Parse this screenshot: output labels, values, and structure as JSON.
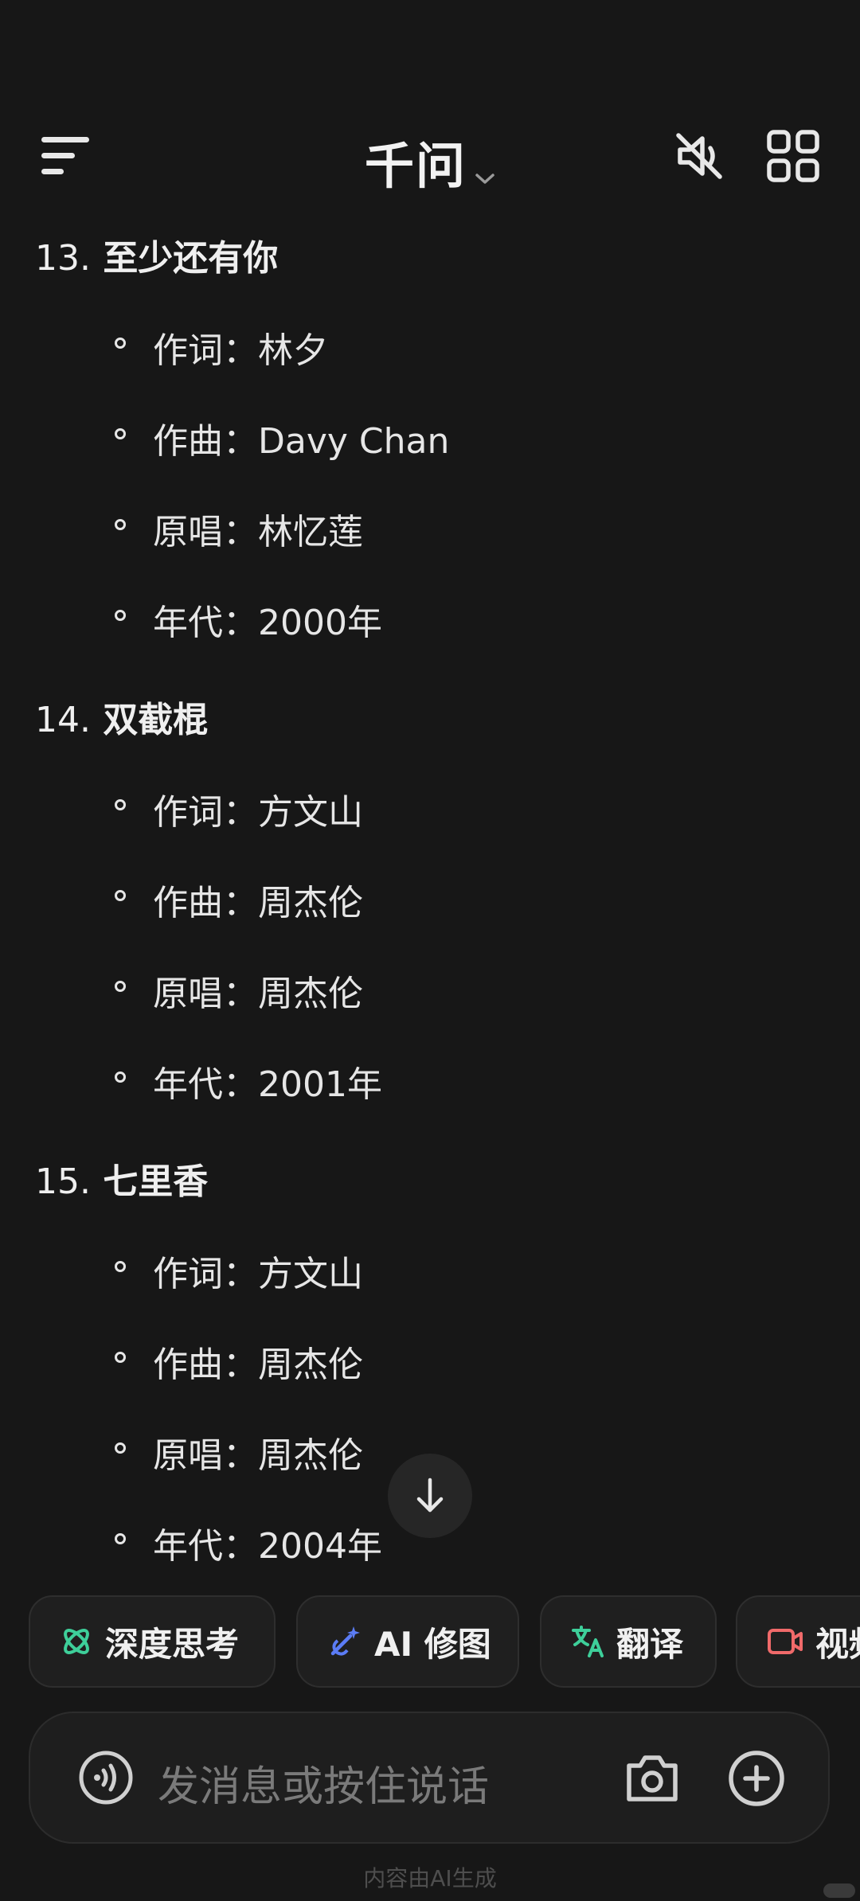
{
  "header": {
    "title": "千问",
    "icons": [
      "menu-icon",
      "chevron-down-icon",
      "mute-icon",
      "apps-grid-icon"
    ]
  },
  "songs": [
    {
      "number": "13.",
      "title": "至少还有你",
      "fields": [
        "作词：林夕",
        "作曲：Davy Chan",
        "原唱：林忆莲",
        "年代：2000年"
      ]
    },
    {
      "number": "14.",
      "title": "双截棍",
      "fields": [
        "作词：方文山",
        "作曲：周杰伦",
        "原唱：周杰伦",
        "年代：2001年"
      ]
    },
    {
      "number": "15.",
      "title": "七里香",
      "fields": [
        "作词：方文山",
        "作曲：周杰伦",
        "原唱：周杰伦",
        "年代：2004年"
      ]
    }
  ],
  "chips": [
    {
      "label": "深度思考",
      "icon": "deep-think-icon",
      "color": "#3ecf9a"
    },
    {
      "label": "AI 修图",
      "icon": "ai-retouch-icon",
      "color": "#5b7cf5"
    },
    {
      "label": "翻译",
      "icon": "translate-icon",
      "color": "#3ecf9a"
    },
    {
      "label": "视频",
      "icon": "video-icon",
      "color": "#f06a6a"
    }
  ],
  "input": {
    "placeholder": "发消息或按住说话"
  },
  "footer": {
    "note": "内容由AI生成"
  }
}
